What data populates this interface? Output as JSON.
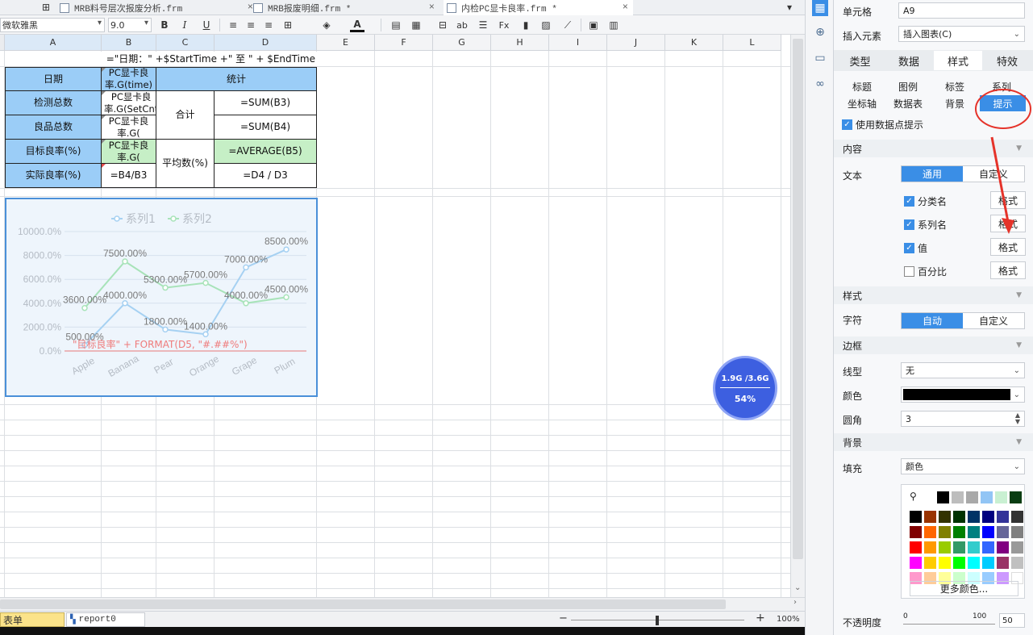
{
  "tabs": [
    {
      "label": "MRB料号层次报废分析.frm"
    },
    {
      "label": "MRB报废明细.frm *"
    },
    {
      "label": "内检PC显卡良率.frm *"
    }
  ],
  "toolbar": {
    "font": "微软雅黑",
    "size": "9.0",
    "bold": "B",
    "italic": "I",
    "underline": "U"
  },
  "columns": [
    "A",
    "B",
    "C",
    "D",
    "E",
    "F",
    "G",
    "H",
    "I",
    "J",
    "K",
    "L"
  ],
  "cells": {
    "a1": "=\"日期：\" +$StartTime +\" 至 \" + $EndTime",
    "a2": "日期",
    "b2": "PC显卡良率.G(time)",
    "c2": "统计",
    "a3": "检测总数",
    "b3": "PC显卡良率.G(SetCnt",
    "c3": "合计",
    "d3": "=SUM(B3)",
    "a4": "良品总数",
    "b4": "PC显卡良率.G(",
    "d4": "=SUM(B4)",
    "a5": "目标良率(%)",
    "b5": "PC显卡良率.G(",
    "c5": "平均数(%)",
    "d5": "=AVERAGE(B5)",
    "a6": "实际良率(%)",
    "b6": "=B4/B3",
    "d6": "=D4 / D3"
  },
  "chart_data": {
    "type": "line",
    "categories": [
      "Apple",
      "Banana",
      "Pear",
      "Orange",
      "Grape",
      "Plum"
    ],
    "series": [
      {
        "name": "系列1",
        "values": [
          500,
          4000,
          1800,
          1400,
          7000,
          8500
        ],
        "labels": [
          "500.00%",
          "4000.00%",
          "1800.00%",
          "1400.00%",
          "7000.00%",
          "8500.00%"
        ],
        "color": "#a6d1f2"
      },
      {
        "name": "系列2",
        "values": [
          3600,
          7500,
          5300,
          5700,
          4000,
          4500
        ],
        "labels": [
          "3600.00%",
          "7500.00%",
          "5300.00%",
          "5700.00%",
          "4000.00%",
          "4500.00%"
        ],
        "color": "#a8e3b9"
      }
    ],
    "yticks": [
      "0.0%",
      "2000.0%",
      "4000.0%",
      "6000.0%",
      "8000.0%",
      "10000.0%"
    ],
    "ylim": [
      0,
      10000
    ],
    "target_line_label": "\"目标良率\" + FORMAT(D5, \"#.##%\")",
    "legend": "top-center",
    "grid": true
  },
  "memory": {
    "usage": "1.9G /3.6G",
    "percent": "54%"
  },
  "sheets": {
    "current": "表单",
    "report": "report0"
  },
  "zoom": {
    "minus": "−",
    "plus": "+",
    "value": "100%"
  },
  "panel": {
    "cell_label": "单元格",
    "cell_value": "A9",
    "insert_label": "插入元素",
    "insert_value": "插入图表(C)",
    "tabs": [
      "类型",
      "数据",
      "样式",
      "特效"
    ],
    "subtabs_row1": [
      "标题",
      "图例",
      "标签",
      "系列"
    ],
    "subtabs_row2": [
      "坐标轴",
      "数据表",
      "背景",
      "提示"
    ],
    "use_tooltip": "使用数据点提示",
    "content": "内容",
    "text": "文本",
    "general": "通用",
    "custom": "自定义",
    "checks": [
      "分类名",
      "系列名",
      "值",
      "百分比"
    ],
    "format": "格式",
    "style": "样式",
    "char": "字符",
    "auto": "自动",
    "custom2": "自定义",
    "border": "边框",
    "linetype": "线型",
    "linetype_value": "无",
    "color": "颜色",
    "radius": "圆角",
    "radius_value": "3",
    "background": "背景",
    "fill": "填充",
    "fill_value": "颜色",
    "more_colors": "更多颜色...",
    "opacity": "不透明度",
    "opacity_min": "0",
    "opacity_max": "100",
    "opacity_value": "50"
  },
  "palette_colors": {
    "accent": "#3a8ee6",
    "annotation": "#e5332a"
  }
}
